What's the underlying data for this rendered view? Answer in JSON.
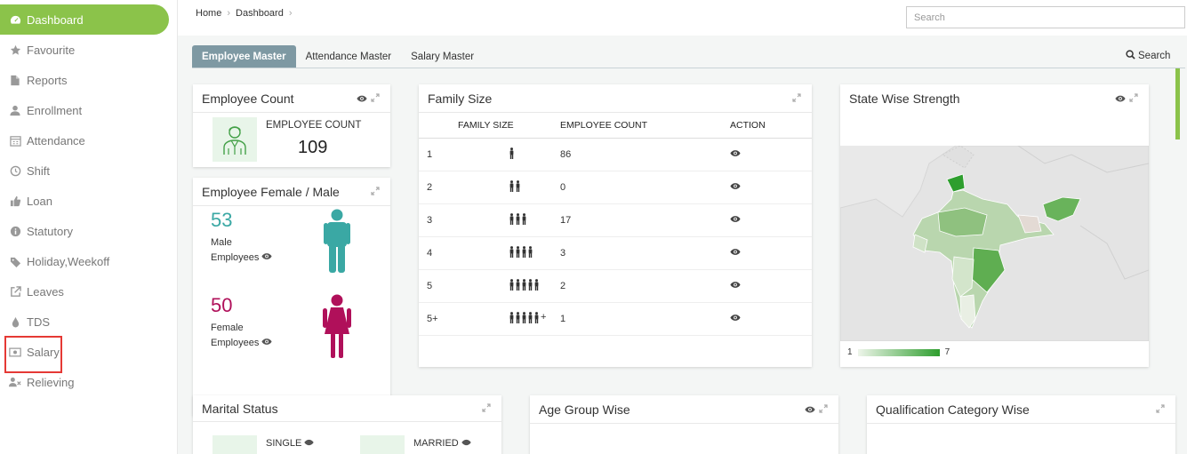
{
  "sidebar": {
    "items": [
      {
        "label": "Dashboard",
        "icon": "dashboard-icon",
        "active": true
      },
      {
        "label": "Favourite",
        "icon": "star-icon"
      },
      {
        "label": "Reports",
        "icon": "file-icon"
      },
      {
        "label": "Enrollment",
        "icon": "user-icon"
      },
      {
        "label": "Attendance",
        "icon": "calendar-icon"
      },
      {
        "label": "Shift",
        "icon": "clock-icon"
      },
      {
        "label": "Loan",
        "icon": "thumbs-up-icon"
      },
      {
        "label": "Statutory",
        "icon": "info-icon"
      },
      {
        "label": "Holiday,Weekoff",
        "icon": "tag-icon"
      },
      {
        "label": "Leaves",
        "icon": "external-link-icon"
      },
      {
        "label": "TDS",
        "icon": "drop-icon"
      },
      {
        "label": "Salary",
        "icon": "money-icon"
      },
      {
        "label": "Relieving",
        "icon": "user-remove-icon"
      }
    ]
  },
  "header": {
    "breadcrumb": [
      "Home",
      "Dashboard"
    ],
    "search_placeholder": "Search"
  },
  "tabs": [
    "Employee Master",
    "Attendance Master",
    "Salary Master"
  ],
  "search_link": "Search",
  "employee_count": {
    "title": "Employee Count",
    "label": "EMPLOYEE COUNT",
    "value": "109"
  },
  "gender": {
    "title": "Employee Female / Male",
    "male_count": "53",
    "male_label_1": "Male",
    "male_label_2": "Employees",
    "female_count": "50",
    "female_label_1": "Female",
    "female_label_2": "Employees",
    "male_color": "#3aa8a4",
    "female_color": "#b0105a"
  },
  "family": {
    "title": "Family Size",
    "headers": [
      "FAMILY SIZE",
      "EMPLOYEE COUNT",
      "ACTION"
    ],
    "rows": [
      {
        "size": "1",
        "count": "86"
      },
      {
        "size": "2",
        "count": "0"
      },
      {
        "size": "3",
        "count": "17"
      },
      {
        "size": "4",
        "count": "3"
      },
      {
        "size": "5",
        "count": "2"
      },
      {
        "size": "5+",
        "count": "1",
        "plus": "+"
      }
    ]
  },
  "state": {
    "title": "State Wise Strength",
    "legend_min": "1",
    "legend_max": "7"
  },
  "marital": {
    "title": "Marital Status",
    "single": "SINGLE",
    "married": "MARRIED"
  },
  "age": {
    "title": "Age Group Wise"
  },
  "qualification": {
    "title": "Qualification Category Wise"
  },
  "colors": {
    "accent": "#8bc34a",
    "tab_active": "#7e99a3",
    "highlight": "#e53935"
  }
}
